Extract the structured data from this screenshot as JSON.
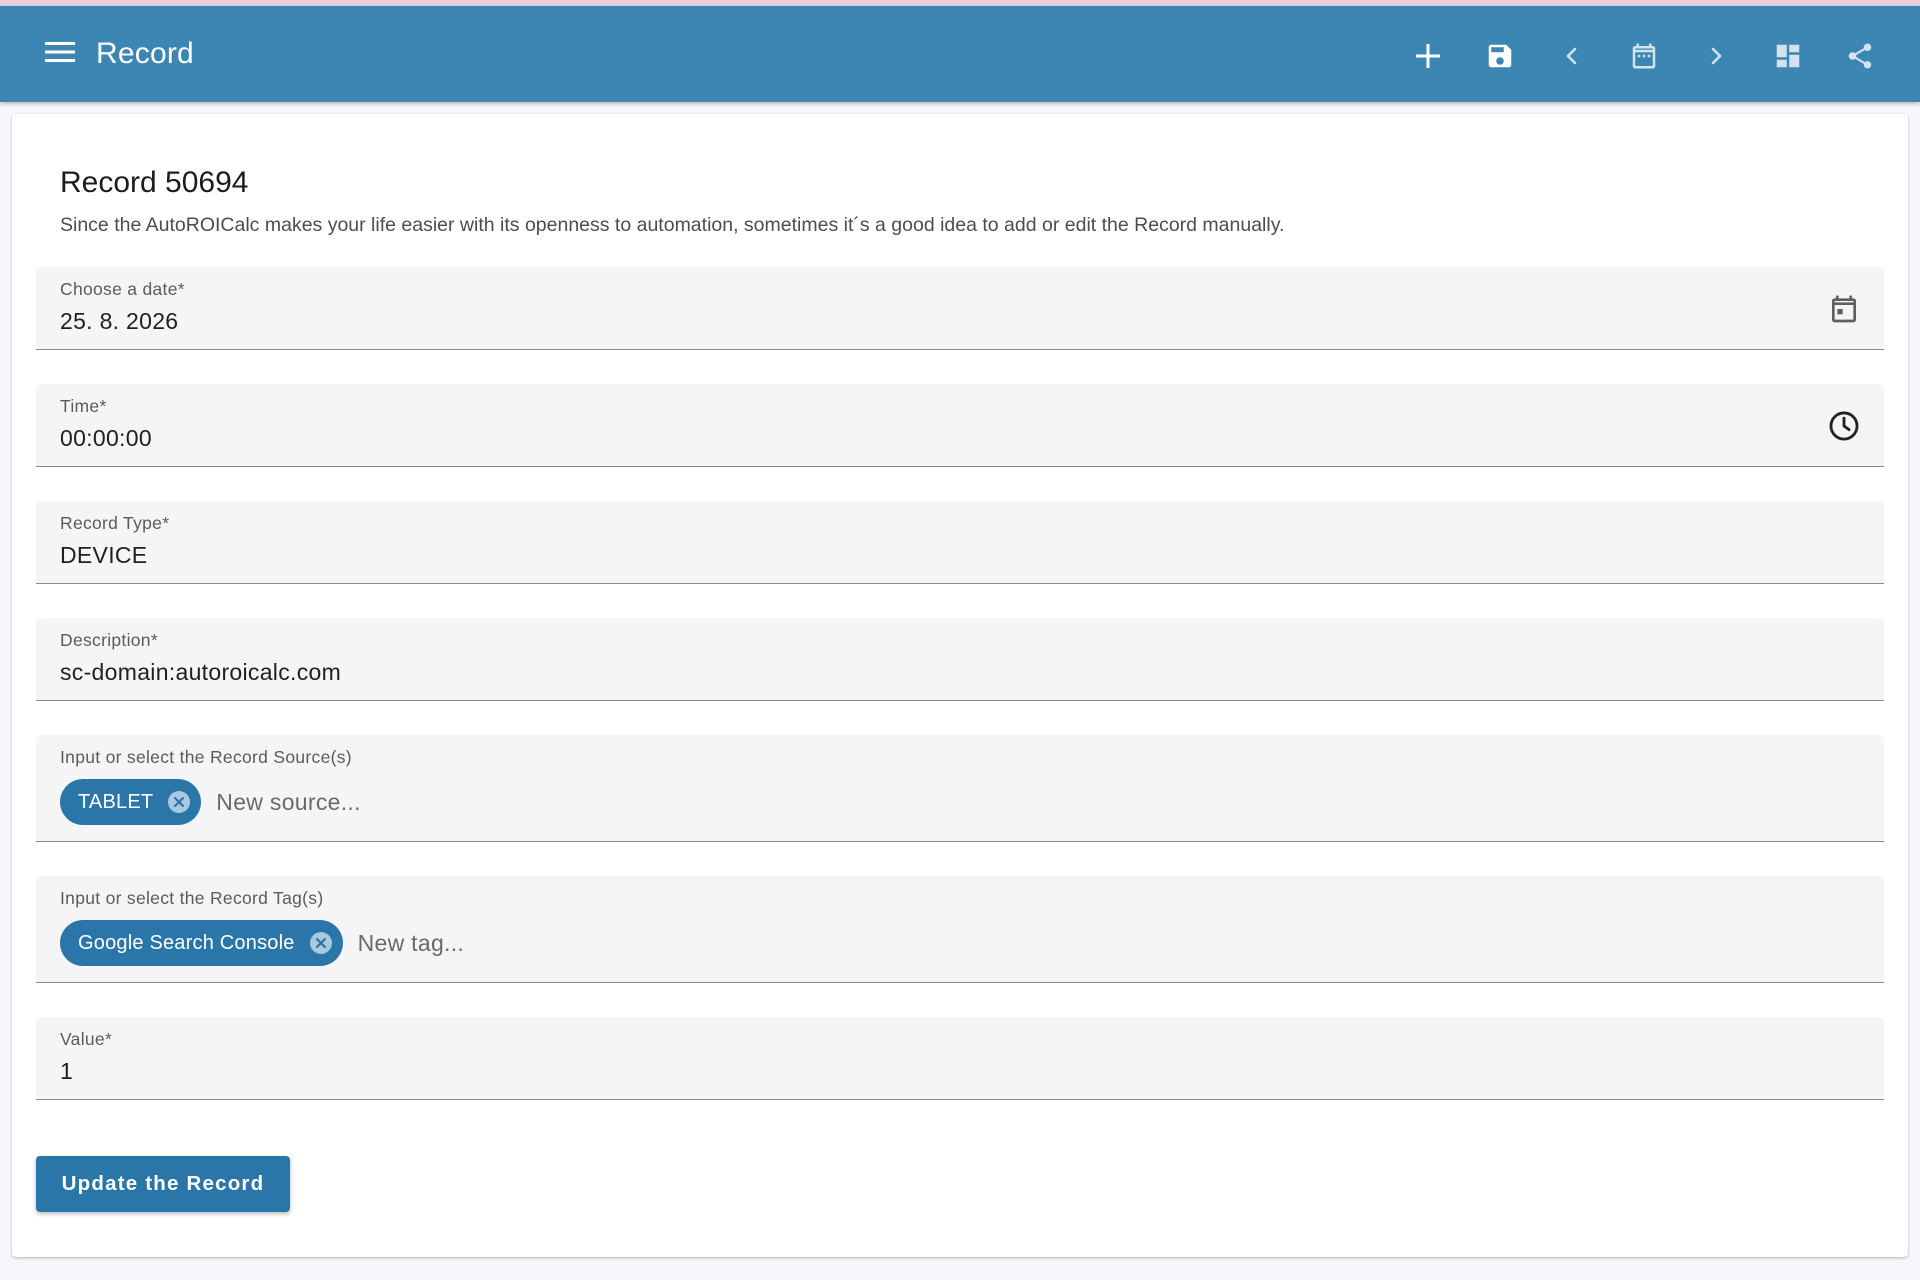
{
  "app_bar": {
    "title": "Record",
    "background": "#3c86b3",
    "actions": [
      {
        "name": "add",
        "icon": "plus-icon"
      },
      {
        "name": "save",
        "icon": "save-icon"
      },
      {
        "name": "previous",
        "icon": "chevron-left-icon"
      },
      {
        "name": "calendar",
        "icon": "calendar-icon"
      },
      {
        "name": "next",
        "icon": "chevron-right-icon"
      },
      {
        "name": "dashboard",
        "icon": "dashboard-icon"
      },
      {
        "name": "share",
        "icon": "share-icon"
      }
    ]
  },
  "form": {
    "title": "Record 50694",
    "subtitle": "Since the AutoROICalc makes your life easier with its openness to automation, sometimes it´s a good idea to add or edit the Record manually.",
    "date": {
      "label": "Choose a date*",
      "value": "25. 8. 2026",
      "icon": "calendar-icon"
    },
    "time": {
      "label": "Time*",
      "value": "00:00:00",
      "icon": "clock-icon"
    },
    "record_type": {
      "label": "Record Type*",
      "value": "DEVICE"
    },
    "description": {
      "label": "Description*",
      "value": "sc-domain:autoroicalc.com"
    },
    "sources": {
      "label": "Input or select the Record Source(s)",
      "chips": [
        "TABLET"
      ],
      "placeholder": "New source..."
    },
    "tags": {
      "label": "Input or select the Record Tag(s)",
      "chips": [
        "Google Search Console"
      ],
      "placeholder": "New tag..."
    },
    "value": {
      "label": "Value*",
      "value": "1"
    },
    "submit_label": "Update the Record"
  },
  "colors": {
    "primary": "#2b76a8",
    "field_background": "#f5f5f5"
  }
}
